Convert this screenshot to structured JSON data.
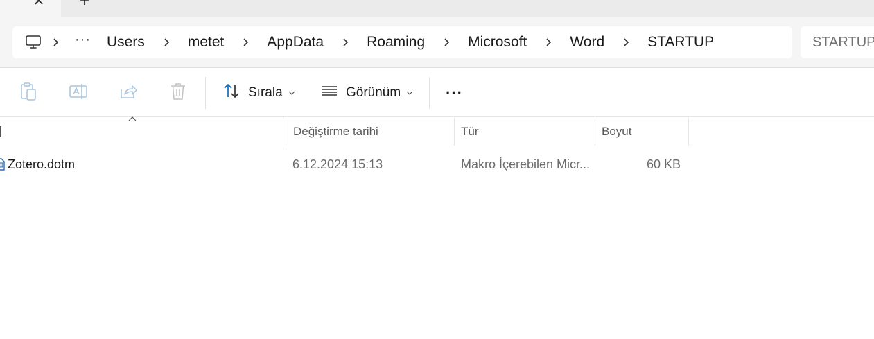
{
  "tabs": {
    "close_glyph": "✕",
    "new_glyph": "+"
  },
  "breadcrumb": {
    "overflow_label": "···",
    "items": [
      "Users",
      "metet",
      "AppData",
      "Roaming",
      "Microsoft",
      "Word",
      "STARTUP"
    ]
  },
  "search": {
    "placeholder": "STARTUP ara"
  },
  "toolbar": {
    "sort_label": "Sırala",
    "view_label": "Görünüm",
    "more_label": "···"
  },
  "columns": {
    "name": "",
    "modified": "Değiştirme tarihi",
    "type": "Tür",
    "size": "Boyut"
  },
  "files": [
    {
      "name": "Zotero.dotm",
      "modified": "6.12.2024 15:13",
      "type": "Makro İçerebilen Micr...",
      "size": "60 KB",
      "icon": "word-macro-template-icon"
    }
  ],
  "colors": {
    "accent": "#0f6cbd",
    "disabled_icon": "#a9c4de",
    "chrome": "#f5f5f5"
  }
}
